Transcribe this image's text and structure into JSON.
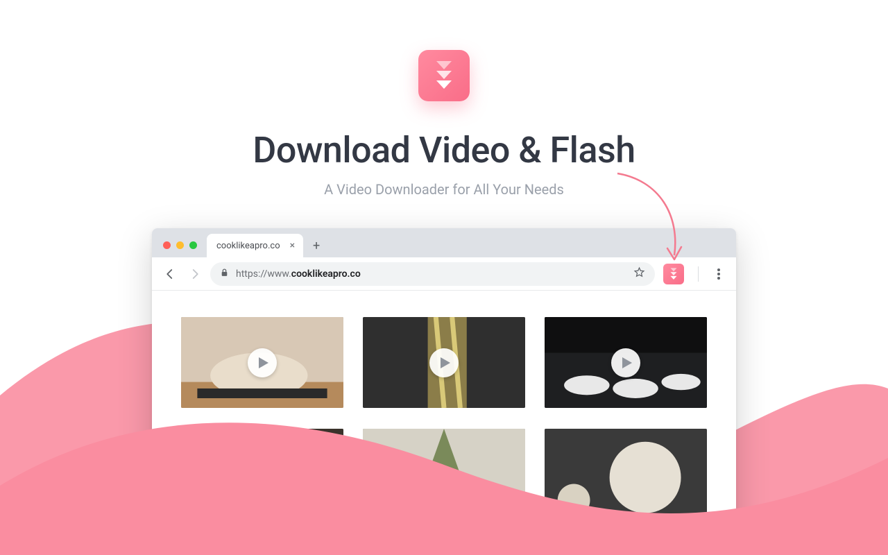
{
  "hero": {
    "title": "Download Video & Flash",
    "subtitle": "A Video Downloader for All Your Needs"
  },
  "browser": {
    "tab_title": "cooklikeapro.co",
    "url_prefix": "https://www.",
    "url_host": "cooklikeapro.co"
  }
}
